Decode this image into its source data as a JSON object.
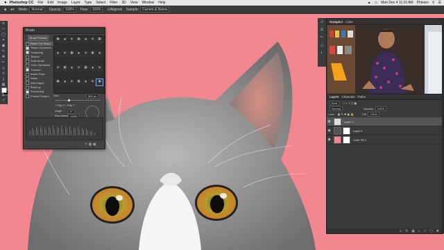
{
  "menubar": {
    "apple": "",
    "app_name": "Photoshop CC",
    "items": [
      "File",
      "Edit",
      "Image",
      "Layer",
      "Type",
      "Select",
      "Filter",
      "3D",
      "View",
      "Window",
      "Help"
    ],
    "clock": "Mon Dec 4 11:16 AM",
    "user": "Phlearn"
  },
  "options_bar": {
    "mode_label": "Mode:",
    "mode_value": "Normal",
    "opacity_label": "Opacity:",
    "opacity_value": "100%",
    "flow_label": "Flow:",
    "flow_value": "100%",
    "aligned_label": "Aligned",
    "sample_label": "Sample:",
    "sample_value": "Current & Below"
  },
  "brush_panel": {
    "title": "Brush",
    "presets_button": "Brush Presets",
    "options": [
      {
        "label": "Brush Tip Shape",
        "checked": false,
        "selected": true
      },
      {
        "label": "Shape Dynamics",
        "checked": true,
        "selected": false
      },
      {
        "label": "Scattering",
        "checked": true,
        "selected": false
      },
      {
        "label": "Texture",
        "checked": false,
        "selected": false
      },
      {
        "label": "Dual Brush",
        "checked": false,
        "selected": false
      },
      {
        "label": "Color Dynamics",
        "checked": false,
        "selected": false
      },
      {
        "label": "Transfer",
        "checked": true,
        "selected": false
      },
      {
        "label": "Brush Pose",
        "checked": false,
        "selected": false
      },
      {
        "label": "Noise",
        "checked": false,
        "selected": false
      },
      {
        "label": "Wet Edges",
        "checked": false,
        "selected": false
      },
      {
        "label": "Build-up",
        "checked": false,
        "selected": false
      },
      {
        "label": "Smoothing",
        "checked": true,
        "selected": false
      },
      {
        "label": "Protect Texture",
        "checked": false,
        "selected": false
      }
    ],
    "tip_numbers": [
      "30",
      "30",
      "30",
      "25",
      "25",
      "25",
      "36",
      "25",
      "36",
      "36",
      "36",
      "32",
      "25",
      "50",
      "25",
      "25",
      "50",
      "71",
      "25",
      "50",
      "50",
      "50",
      "36",
      "36",
      "36",
      "36",
      "70",
      "112"
    ],
    "size_label": "Size",
    "size_value": "300 px",
    "flip_x": "Flip X",
    "flip_y": "Flip Y",
    "angle_label": "Angle:",
    "angle_value": "0°",
    "roundness_label": "Roundness:",
    "roundness_value": "100%",
    "hardness_label": "Hardness",
    "spacing_label": "Spacing",
    "spacing_value": "10%",
    "footer_icons": [
      "brush-edit-icon",
      "grid-icon",
      "new-preset-icon"
    ]
  },
  "navigator": {
    "tabs": [
      "Navigator",
      "Color"
    ]
  },
  "layers_panel": {
    "tabs": [
      "Layers",
      "Channels",
      "Paths"
    ],
    "kind_label": "Kind",
    "blend_mode": "Normal",
    "opacity_label": "Opacity:",
    "opacity_value": "100%",
    "lock_label": "Lock:",
    "fill_label": "Fill:",
    "fill_value": "100%",
    "layers": [
      {
        "name": "Layer 1",
        "selected": true,
        "thumb": "#dcdcdc"
      },
      {
        "name": "Layer 0",
        "selected": false,
        "thumb": "#444"
      },
      {
        "name": "Color Fill 1",
        "selected": false,
        "thumb": "#f0868e"
      }
    ]
  },
  "colors": {
    "background_pink": "#f0868e",
    "panel": "#424242",
    "panel_dark": "#2d2d2d",
    "iris": "#d89a2a"
  }
}
